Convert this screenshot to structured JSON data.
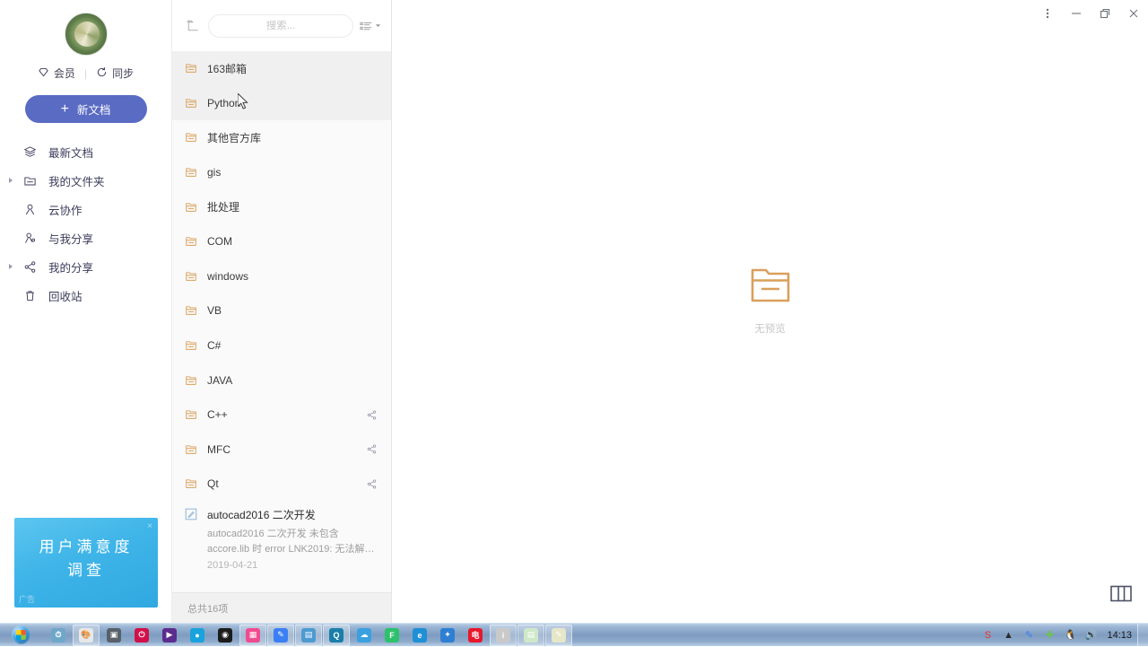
{
  "window": {
    "menu_icon": "more-vertical-icon",
    "minimize_icon": "minimize-icon",
    "restore_icon": "restore-icon",
    "close_icon": "close-icon"
  },
  "sidebar": {
    "avatar_alt": "user-avatar",
    "vip": {
      "label": "会员",
      "icon": "diamond-icon"
    },
    "sync": {
      "label": "同步",
      "icon": "refresh-icon"
    },
    "new_doc": {
      "label": "新文档",
      "icon": "plus-icon"
    },
    "items": [
      {
        "label": "最新文档",
        "icon": "layers-icon",
        "expandable": false
      },
      {
        "label": "我的文件夹",
        "icon": "folder-icon",
        "expandable": true
      },
      {
        "label": "云协作",
        "icon": "user-icon",
        "expandable": false
      },
      {
        "label": "与我分享",
        "icon": "user-shared-icon",
        "expandable": false
      },
      {
        "label": "我的分享",
        "icon": "share-icon",
        "expandable": true
      },
      {
        "label": "回收站",
        "icon": "trash-icon",
        "expandable": false
      }
    ],
    "ad": {
      "line1": "用户满意度",
      "line2": "调查",
      "tag": "广告",
      "close": "×"
    }
  },
  "filelist": {
    "up_icon": "arrow-up-folder-icon",
    "search_placeholder": "搜索...",
    "search_value": "",
    "view_icon": "list-view-icon",
    "status": "总共16项",
    "rows": [
      {
        "name": "163邮箱",
        "type": "folder",
        "selected": true,
        "shared": false
      },
      {
        "name": "Python",
        "type": "folder",
        "selected": true,
        "shared": false
      },
      {
        "name": "其他官方库",
        "type": "folder",
        "selected": false,
        "shared": false
      },
      {
        "name": "gis",
        "type": "folder",
        "selected": false,
        "shared": false
      },
      {
        "name": "批处理",
        "type": "folder",
        "selected": false,
        "shared": false
      },
      {
        "name": "COM",
        "type": "folder",
        "selected": false,
        "shared": false
      },
      {
        "name": "windows",
        "type": "folder",
        "selected": false,
        "shared": false
      },
      {
        "name": "VB",
        "type": "folder",
        "selected": false,
        "shared": false
      },
      {
        "name": "C#",
        "type": "folder",
        "selected": false,
        "shared": false
      },
      {
        "name": "JAVA",
        "type": "folder",
        "selected": false,
        "shared": false
      },
      {
        "name": "C++",
        "type": "folder",
        "selected": false,
        "shared": true
      },
      {
        "name": "MFC",
        "type": "folder",
        "selected": false,
        "shared": true
      },
      {
        "name": "Qt",
        "type": "folder",
        "selected": false,
        "shared": true
      }
    ],
    "document": {
      "icon": "note-doc-icon",
      "title": "autocad2016 二次开发",
      "snippet": "autocad2016 二次开发 未包含 accore.lib 时 error LNK2019: 无法解析的外部符号...",
      "date": "2019-04-21"
    }
  },
  "preview": {
    "icon": "large-folder-icon",
    "empty_text": "无预览",
    "toggle_icon": "split-panel-icon"
  },
  "taskbar": {
    "start_label": "start-orb",
    "apps": [
      {
        "name": "clock-app",
        "color": "#6fa7c9",
        "glyph": "⏱",
        "active": false
      },
      {
        "name": "paint-app",
        "color": "#e8e8e8",
        "glyph": "🎨",
        "active": true
      },
      {
        "name": "camera-app",
        "color": "#58606a",
        "glyph": "▣",
        "active": false
      },
      {
        "name": "media-app",
        "color": "#d1104a",
        "glyph": "⏻",
        "active": false
      },
      {
        "name": "video-app",
        "color": "#5b2d8e",
        "glyph": "▶",
        "active": false
      },
      {
        "name": "messenger-app",
        "color": "#19a3dc",
        "glyph": "●",
        "active": false
      },
      {
        "name": "recorder-app",
        "color": "#1c1c1c",
        "glyph": "◉",
        "active": false
      },
      {
        "name": "photo-app",
        "color": "#f14b90",
        "glyph": "▦",
        "active": true
      },
      {
        "name": "note-app",
        "color": "#3b7ff5",
        "glyph": "✎",
        "active": true
      },
      {
        "name": "scan-app",
        "color": "#4d9ad1",
        "glyph": "▤",
        "active": true
      },
      {
        "name": "browser-app",
        "color": "#1a7fa8",
        "glyph": "Q",
        "active": true
      },
      {
        "name": "cloud-app",
        "color": "#3aa0e0",
        "glyph": "☁",
        "active": false
      },
      {
        "name": "green-app",
        "color": "#2ec16b",
        "glyph": "F",
        "active": false
      },
      {
        "name": "edge-app",
        "color": "#1f8fd6",
        "glyph": "e",
        "active": false
      },
      {
        "name": "bird-app",
        "color": "#2e7fd4",
        "glyph": "✦",
        "active": false
      },
      {
        "name": "red-app",
        "color": "#e8172b",
        "glyph": "电",
        "active": false
      },
      {
        "name": "info-app",
        "color": "#c9c9c9",
        "glyph": "i",
        "active": true
      },
      {
        "name": "notepad-app",
        "color": "#cfe8c8",
        "glyph": "▤",
        "active": true
      },
      {
        "name": "editor-app",
        "color": "#e6e6c8",
        "glyph": "✎",
        "active": true
      }
    ],
    "tray": [
      {
        "name": "sogou-tray-icon",
        "color": "#e8342a",
        "glyph": "S"
      },
      {
        "name": "chevron-up-icon",
        "color": "#2b2b2b",
        "glyph": "▲"
      },
      {
        "name": "note-tray-icon",
        "color": "#3b7ff5",
        "glyph": "✎"
      },
      {
        "name": "shield-tray-icon",
        "color": "#6dc04e",
        "glyph": "✚"
      },
      {
        "name": "qq-tray-icon",
        "color": "#2b2b2b",
        "glyph": "🐧"
      },
      {
        "name": "volume-icon",
        "color": "#2b2b2b",
        "glyph": "🔊"
      }
    ],
    "clock": "14:13"
  },
  "colors": {
    "accent": "#5a6bc4",
    "folder": "#d9a05b",
    "sidebar_icon": "#3b3b5c",
    "ad_bg": "#3eb4e8"
  }
}
